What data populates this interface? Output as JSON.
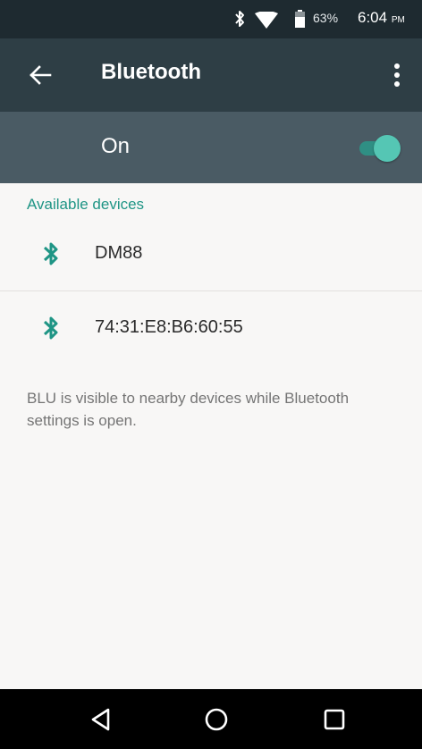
{
  "status_bar": {
    "battery_percent": "63%",
    "time": "6:04",
    "time_suffix": "PM",
    "icons": [
      "bluetooth-icon",
      "wifi-icon",
      "battery-icon"
    ]
  },
  "app_bar": {
    "title": "Bluetooth",
    "icons": [
      "back-arrow-icon",
      "more-vert-icon"
    ]
  },
  "bluetooth_toggle": {
    "label": "On",
    "state": "on"
  },
  "devices": {
    "header": "Available devices",
    "items": [
      {
        "name": "DM88",
        "icon": "bluetooth-icon"
      },
      {
        "name": "74:31:E8:B6:60:55",
        "icon": "bluetooth-icon"
      }
    ]
  },
  "info_text": "BLU is visible to nearby devices while Bluetooth settings is open.",
  "nav_bar": {
    "icons": [
      "nav-back-icon",
      "nav-home-icon",
      "nav-recents-icon"
    ]
  },
  "colors": {
    "status_bar": "#1e2a30",
    "app_bar": "#2e3e45",
    "toggle_row": "#4a5b64",
    "accent": "#1f9585",
    "background": "#f8f7f6"
  }
}
